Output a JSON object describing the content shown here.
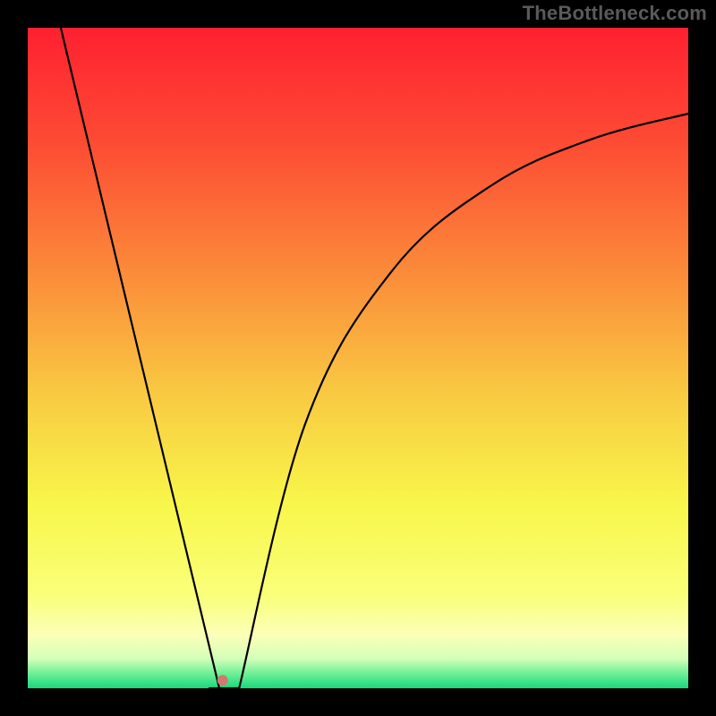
{
  "watermark": "TheBottleneck.com",
  "chart_data": {
    "type": "line",
    "title": "",
    "xlabel": "",
    "ylabel": "",
    "xlim": [
      0,
      100
    ],
    "ylim": [
      0,
      100
    ],
    "minimum_x": 29,
    "marker": {
      "x": 29.5,
      "y": 1.2,
      "color": "#cf7a6d",
      "radius": 6
    },
    "series": [
      {
        "name": "left-branch",
        "x": [
          5,
          29
        ],
        "y": [
          100,
          0
        ],
        "path": "linear"
      },
      {
        "name": "valley-floor",
        "x": [
          26,
          32
        ],
        "y": [
          0,
          0
        ],
        "path": "flat"
      },
      {
        "name": "right-branch",
        "x": [
          32,
          42,
          55,
          70,
          85,
          100
        ],
        "y": [
          0,
          40,
          63,
          76,
          83,
          87
        ],
        "path": "smooth"
      }
    ],
    "background_gradient": {
      "type": "vertical",
      "stops": [
        {
          "offset": 0.0,
          "color": "#fe2030"
        },
        {
          "offset": 0.18,
          "color": "#fd4d34"
        },
        {
          "offset": 0.38,
          "color": "#fb8e3a"
        },
        {
          "offset": 0.55,
          "color": "#f9c842"
        },
        {
          "offset": 0.72,
          "color": "#f8f64a"
        },
        {
          "offset": 0.86,
          "color": "#faff7a"
        },
        {
          "offset": 0.92,
          "color": "#fcffb8"
        },
        {
          "offset": 0.955,
          "color": "#d4ffb9"
        },
        {
          "offset": 0.975,
          "color": "#7af29a"
        },
        {
          "offset": 1.0,
          "color": "#18d87d"
        }
      ]
    }
  }
}
